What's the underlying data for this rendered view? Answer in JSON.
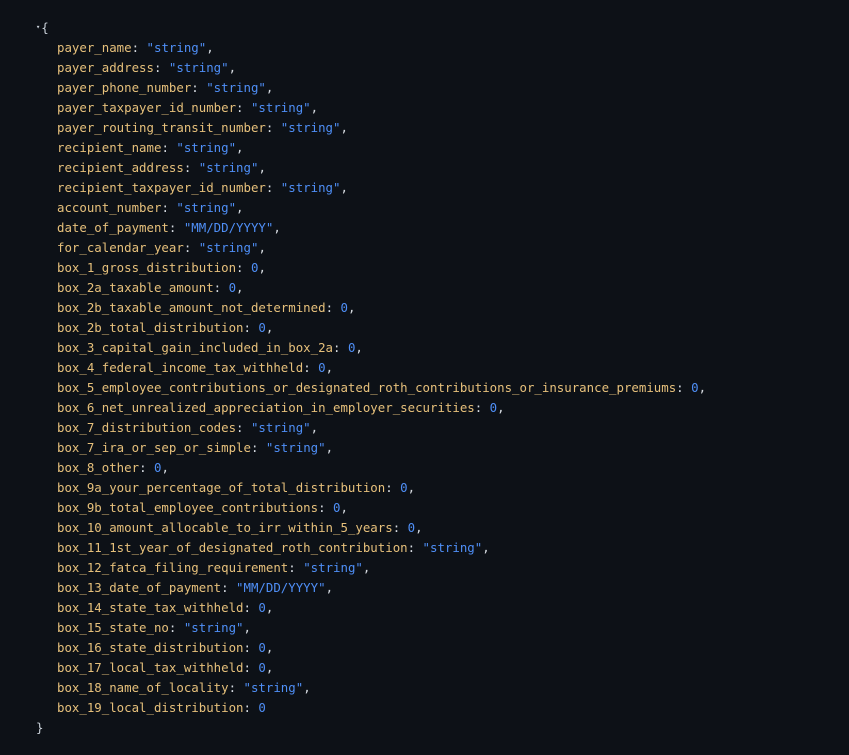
{
  "viewer": {
    "toggle_glyph": "▾",
    "open_brace": "{",
    "close_brace": "}",
    "colors": {
      "background": "#0d1117",
      "key": "#e6c07b",
      "value": "#4f8ff7",
      "punctuation": "#d7dce2"
    },
    "fields": [
      {
        "key": "payer_name",
        "value": "\"string\"",
        "type": "string"
      },
      {
        "key": "payer_address",
        "value": "\"string\"",
        "type": "string"
      },
      {
        "key": "payer_phone_number",
        "value": "\"string\"",
        "type": "string"
      },
      {
        "key": "payer_taxpayer_id_number",
        "value": "\"string\"",
        "type": "string"
      },
      {
        "key": "payer_routing_transit_number",
        "value": "\"string\"",
        "type": "string"
      },
      {
        "key": "recipient_name",
        "value": "\"string\"",
        "type": "string"
      },
      {
        "key": "recipient_address",
        "value": "\"string\"",
        "type": "string"
      },
      {
        "key": "recipient_taxpayer_id_number",
        "value": "\"string\"",
        "type": "string"
      },
      {
        "key": "account_number",
        "value": "\"string\"",
        "type": "string"
      },
      {
        "key": "date_of_payment",
        "value": "\"MM/DD/YYYY\"",
        "type": "string"
      },
      {
        "key": "for_calendar_year",
        "value": "\"string\"",
        "type": "string"
      },
      {
        "key": "box_1_gross_distribution",
        "value": "0",
        "type": "number"
      },
      {
        "key": "box_2a_taxable_amount",
        "value": "0",
        "type": "number"
      },
      {
        "key": "box_2b_taxable_amount_not_determined",
        "value": "0",
        "type": "number"
      },
      {
        "key": "box_2b_total_distribution",
        "value": "0",
        "type": "number"
      },
      {
        "key": "box_3_capital_gain_included_in_box_2a",
        "value": "0",
        "type": "number"
      },
      {
        "key": "box_4_federal_income_tax_withheld",
        "value": "0",
        "type": "number"
      },
      {
        "key": "box_5_employee_contributions_or_designated_roth_contributions_or_insurance_premiums",
        "value": "0",
        "type": "number"
      },
      {
        "key": "box_6_net_unrealized_appreciation_in_employer_securities",
        "value": "0",
        "type": "number"
      },
      {
        "key": "box_7_distribution_codes",
        "value": "\"string\"",
        "type": "string"
      },
      {
        "key": "box_7_ira_or_sep_or_simple",
        "value": "\"string\"",
        "type": "string"
      },
      {
        "key": "box_8_other",
        "value": "0",
        "type": "number"
      },
      {
        "key": "box_9a_your_percentage_of_total_distribution",
        "value": "0",
        "type": "number"
      },
      {
        "key": "box_9b_total_employee_contributions",
        "value": "0",
        "type": "number"
      },
      {
        "key": "box_10_amount_allocable_to_irr_within_5_years",
        "value": "0",
        "type": "number"
      },
      {
        "key": "box_11_1st_year_of_designated_roth_contribution",
        "value": "\"string\"",
        "type": "string"
      },
      {
        "key": "box_12_fatca_filing_requirement",
        "value": "\"string\"",
        "type": "string"
      },
      {
        "key": "box_13_date_of_payment",
        "value": "\"MM/DD/YYYY\"",
        "type": "string"
      },
      {
        "key": "box_14_state_tax_withheld",
        "value": "0",
        "type": "number"
      },
      {
        "key": "box_15_state_no",
        "value": "\"string\"",
        "type": "string"
      },
      {
        "key": "box_16_state_distribution",
        "value": "0",
        "type": "number"
      },
      {
        "key": "box_17_local_tax_withheld",
        "value": "0",
        "type": "number"
      },
      {
        "key": "box_18_name_of_locality",
        "value": "\"string\"",
        "type": "string"
      },
      {
        "key": "box_19_local_distribution",
        "value": "0",
        "type": "number"
      }
    ]
  }
}
